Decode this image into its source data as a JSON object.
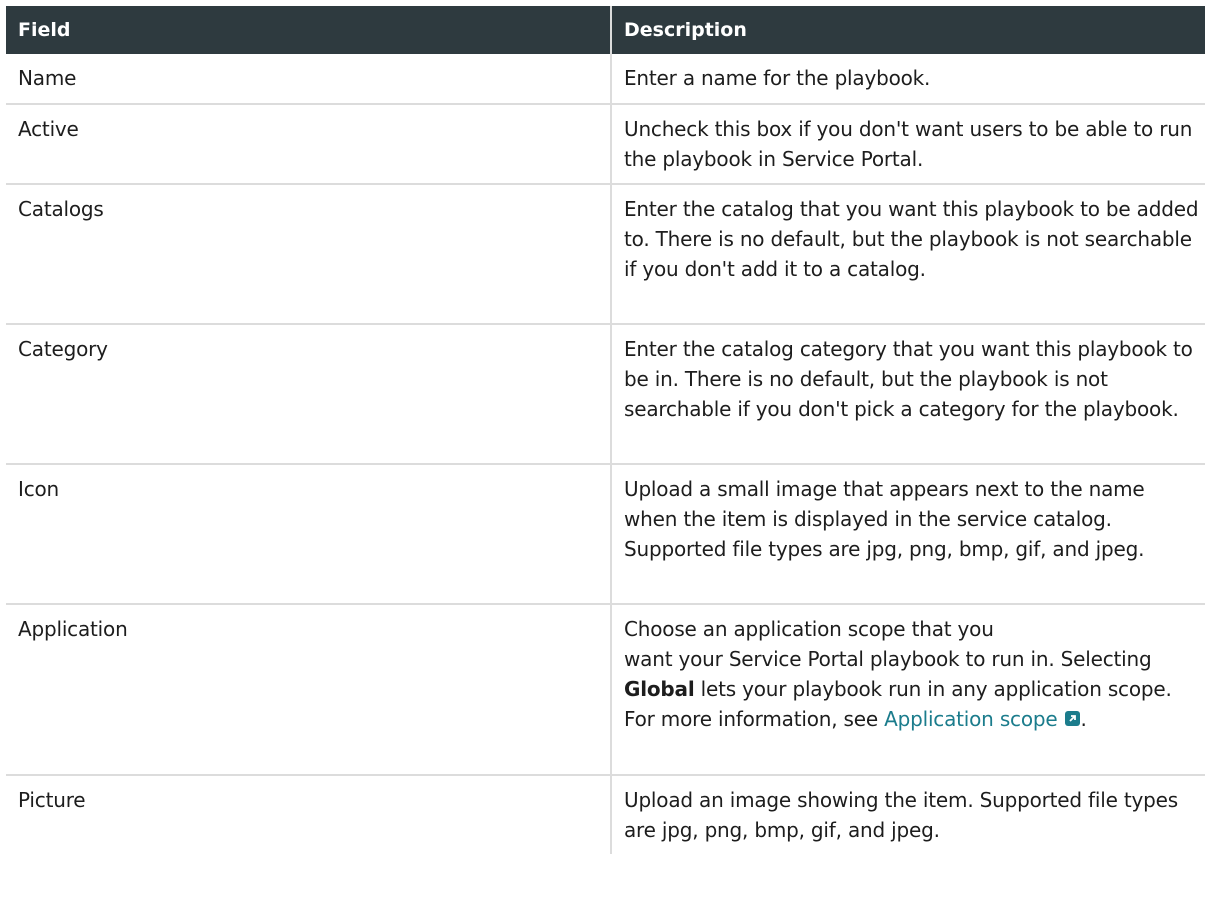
{
  "table": {
    "headers": {
      "field": "Field",
      "description": "Description"
    },
    "rows": [
      {
        "field": "Name",
        "description": "Enter a name for the playbook."
      },
      {
        "field": "Active",
        "description": "Uncheck this box if you don't want users to be able to run the playbook in Service Portal."
      },
      {
        "field": "Catalogs",
        "description": "Enter the catalog that you want this playbook to be added to. There is no default, but the playbook is not searchable if you don't add it to a catalog."
      },
      {
        "field": "Category",
        "description": "Enter the catalog category that you want this playbook to be in. There is no default, but the playbook is not searchable if you don't pick a category for the playbook."
      },
      {
        "field": "Icon",
        "description": "Upload a small image that appears next to the name when the item is displayed in the service catalog. Supported file types are jpg, png, bmp, gif, and jpeg."
      },
      {
        "field": "Application",
        "description_parts": {
          "line1": "Choose an application scope that you",
          "line2": "want your Service Portal playbook to run in. Selecting ",
          "strong": "Global",
          "after_strong": " lets your playbook run in any application scope. For more information, see ",
          "link_text": "Application scope",
          "link_icon": "external-link-icon",
          "end": "."
        }
      },
      {
        "field": "Picture",
        "description": "Upload an image showing the item. Supported file types are jpg, png, bmp, gif, and jpeg."
      }
    ]
  },
  "colors": {
    "header_bg": "#2e3a3f",
    "header_text": "#ffffff",
    "link": "#1b7c8c",
    "border": "#dcdcdc"
  }
}
